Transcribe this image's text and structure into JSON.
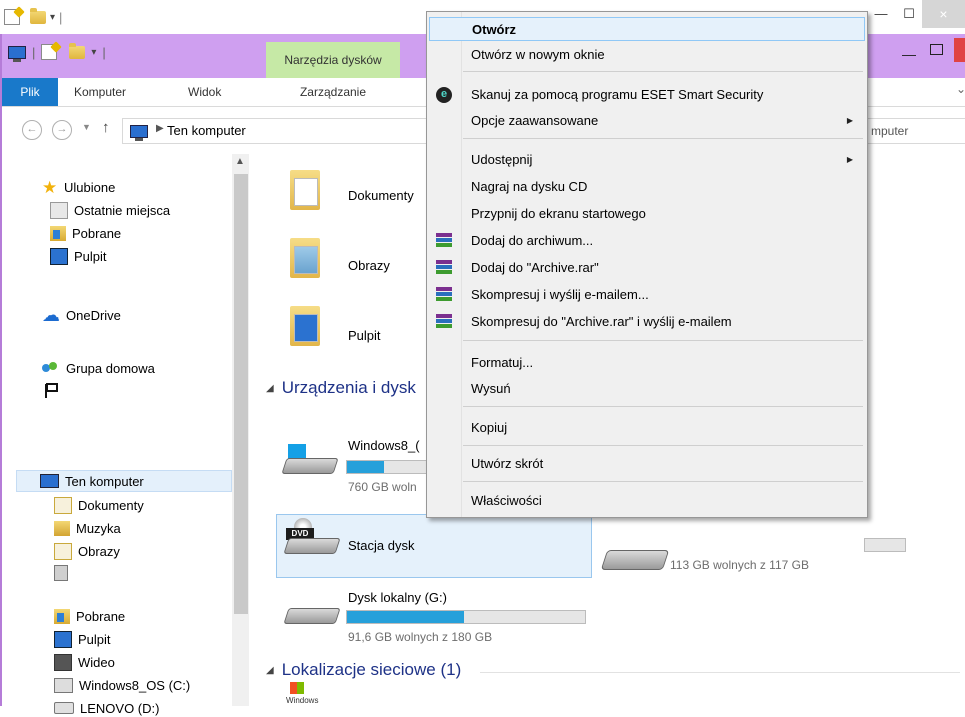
{
  "back_window": {
    "close_glyph": "×"
  },
  "window": {
    "tools_tab": "Narzędzia dysków",
    "ribbon": {
      "file": "Plik",
      "computer": "Komputer",
      "view": "Widok",
      "manage": "Zarządzanie"
    },
    "address": {
      "path": "Ten komputer",
      "search_placeholder": "mputer"
    }
  },
  "nav_pane": {
    "favorites": "Ulubione",
    "recent": "Ostatnie miejsca",
    "downloads": "Pobrane",
    "desktop": "Pulpit",
    "onedrive": "OneDrive",
    "homegroup": "Grupa domowa",
    "this_pc": "Ten komputer",
    "items": [
      "Dokumenty",
      "Muzyka",
      "Obrazy",
      "Pobrane",
      "Pulpit",
      "Wideo",
      "Windows8_OS (C:)",
      "LENOVO (D:)"
    ]
  },
  "content": {
    "folders": [
      "Dokumenty",
      "Obrazy",
      "Pulpit"
    ],
    "section_devices": "Urządzenia i dysk",
    "section_network": "Lokalizacje sieciowe (1)",
    "drives": [
      {
        "name": "Windows8_(",
        "free": "760 GB woln",
        "used_fraction": 0.45
      },
      {
        "name": "Stacja dysk",
        "free": "",
        "used_fraction": 0
      },
      {
        "name": "Dysk lokalny (G:)",
        "free": "91,6 GB wolnych z 180 GB",
        "used_fraction": 0.49
      }
    ],
    "hidden_drive_free": "113 GB wolnych z 117 GB",
    "dvd_badge": "DVD",
    "wmp_label": "Windows"
  },
  "context_menu": {
    "items": [
      {
        "label": "Otwórz",
        "bold": true
      },
      {
        "label": "Otwórz w nowym oknie"
      },
      {
        "label": "Skanuj za pomocą programu ESET Smart Security",
        "icon": "eset-icon"
      },
      {
        "label": "Opcje zaawansowane",
        "submenu": true
      },
      {
        "label": "Udostępnij",
        "submenu": true
      },
      {
        "label": "Nagraj na dysku CD"
      },
      {
        "label": "Przypnij do ekranu startowego"
      },
      {
        "label": "Dodaj do archiwum...",
        "icon": "winrar-icon"
      },
      {
        "label": "Dodaj do \"Archive.rar\"",
        "icon": "winrar-icon"
      },
      {
        "label": "Skompresuj i wyślij e-mailem...",
        "icon": "winrar-icon"
      },
      {
        "label": "Skompresuj do \"Archive.rar\" i wyślij e-mailem",
        "icon": "winrar-icon"
      },
      {
        "label": "Formatuj..."
      },
      {
        "label": "Wysuń"
      },
      {
        "label": "Kopiuj"
      },
      {
        "label": "Utwórz skrót"
      },
      {
        "label": "Właściwości"
      }
    ],
    "submenu_arrow": "▶",
    "eset_glyph": "e"
  }
}
